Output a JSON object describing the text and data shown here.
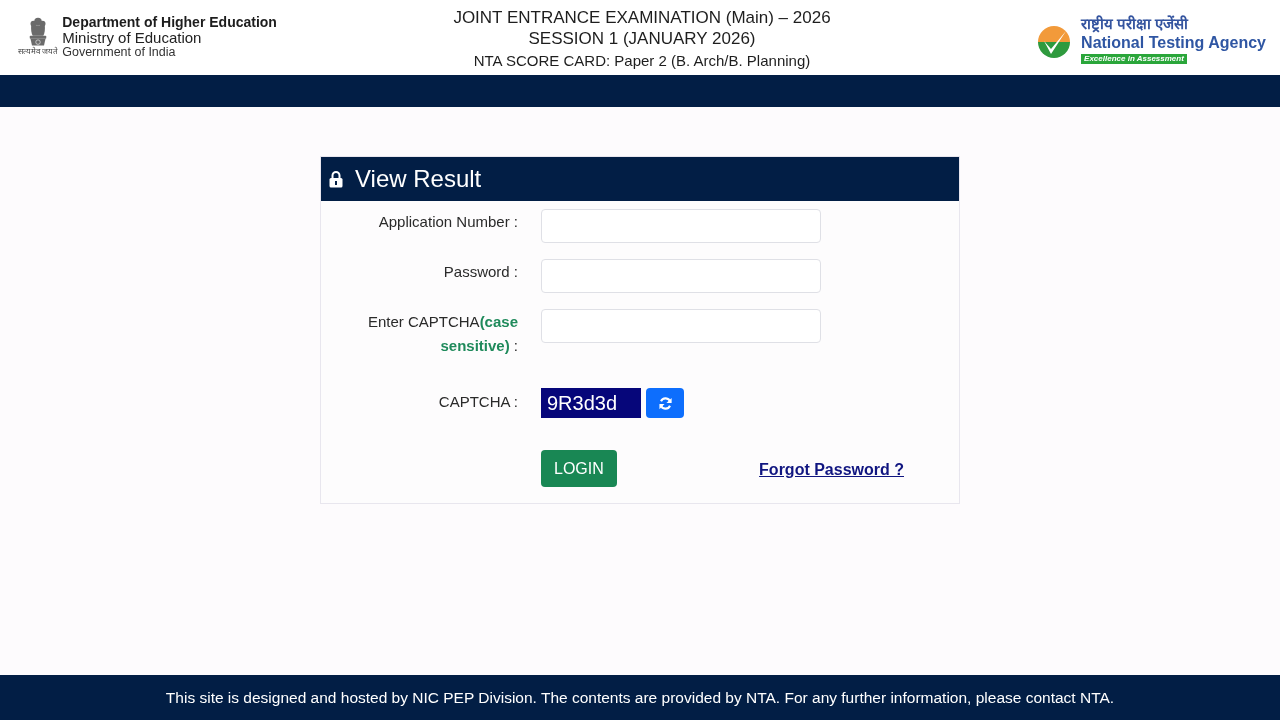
{
  "header": {
    "emblem_motto": "सत्यमेव जयते",
    "department": "Department of Higher Education",
    "ministry": "Ministry of Education",
    "government": "Government of India",
    "title_lines": [
      "JOINT ENTRANCE EXAMINATION (Main) – 2026",
      "SESSION 1 (JANUARY 2026)",
      "NTA SCORE CARD: Paper 2 (B. Arch/B. Planning)"
    ],
    "agency": {
      "hindi_name": "राष्ट्रीय परीक्षा एजेंसी",
      "name": "National Testing Agency",
      "tagline": "Excellence in Assessment"
    }
  },
  "login_card": {
    "title": "View Result",
    "fields": [
      {
        "label": "Application Number :"
      },
      {
        "label": "Password :"
      },
      {
        "label": "Enter CAPTCHA**(case sensitive)** :"
      }
    ],
    "captcha": {
      "label": "CAPTCHA :",
      "code": "9R3d3d"
    },
    "login_button": "LOGIN",
    "forgot_link": "Forgot Password ?"
  },
  "footer": "This site is designed and hosted by NIC PEP Division. The contents are provided by NTA. For any further information, please contact NTA."
}
